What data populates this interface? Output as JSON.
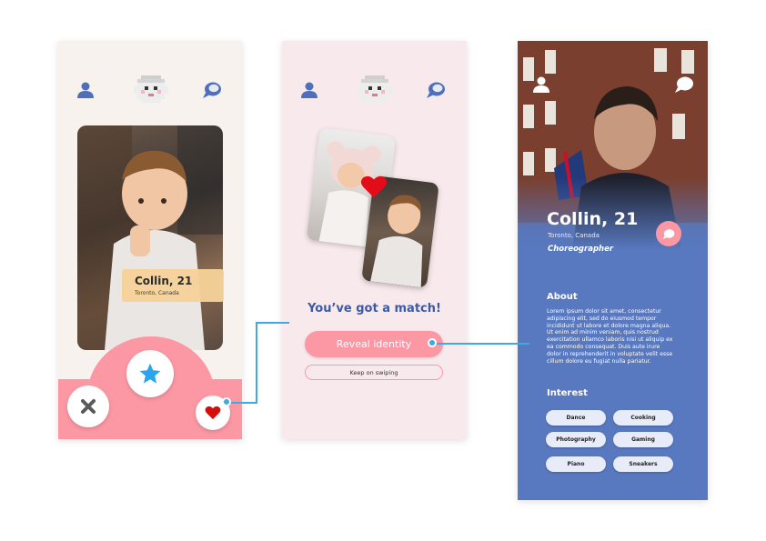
{
  "screen1": {
    "card": {
      "name": "Collin, 21",
      "location": "Toronto, Canada"
    },
    "actions": {
      "dislike": "close-icon",
      "superlike": "star-icon",
      "like": "heart-icon"
    }
  },
  "screen2": {
    "match_title": "You’ve got a match!",
    "reveal_label": "Reveal identity",
    "keep_label": "Keep on swiping"
  },
  "screen3": {
    "name": "Collin, 21",
    "location": "Toronto, Canada",
    "occupation": "Choreographer",
    "about_heading": "About",
    "about_text": "Lorem ipsum dolor sit amet, consectetur adipiscing elit, sed do eiusmod tempor incididunt ut labore et dolore magna aliqua. Ut enim ad minim veniam, quis nostrud exercitation ullamco laboris nisi ut aliquip ex ea commodo consequat. Duis aute irure dolor in reprehenderit in voluptate velit esse cillum dolore eu fugiat nulla pariatur.",
    "interest_heading": "Interest",
    "interests": [
      "Dance",
      "Cooking",
      "Photography",
      "Gaming",
      "Piano",
      "Sneakers"
    ]
  },
  "colors": {
    "accent_pink": "#fc98a4",
    "profile_blue": "#5878bf",
    "title_blue": "#3d5aa6",
    "connector": "#3fa9e0",
    "heart_red": "#d60d0d",
    "star_blue": "#2aa4ec"
  }
}
